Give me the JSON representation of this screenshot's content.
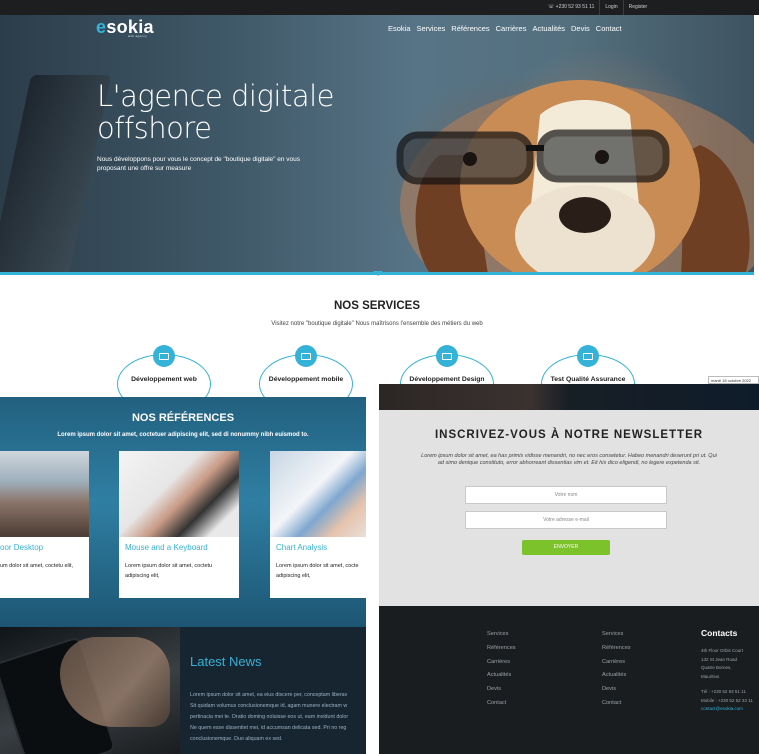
{
  "topbar": {
    "phone": "+230 52 93 51 11",
    "login": "Login",
    "register": "Register"
  },
  "brand": {
    "logo_e": "e",
    "logo_rest": "sokia",
    "logo_sub": "web agency"
  },
  "nav": [
    "Esokia",
    "Services",
    "Références",
    "Carrières",
    "Actualités",
    "Devis",
    "Contact"
  ],
  "hero": {
    "title": "L'agence digitale offshore",
    "desc": "Nous développons pour vous le concept de \"boutique digitale\" en vous proposant une offre sur measure"
  },
  "services": {
    "title": "NOS SERVICES",
    "subtitle": "Visitez notre \"boutique digitale\" Nous maîtrisons l'ensemble des métiers du web",
    "items": [
      "Développement web",
      "Développement mobile",
      "Développement Design",
      "Test Qualité Assurance"
    ]
  },
  "date_tag": "mardi 18 octobre 2022",
  "references": {
    "title": "NOS RÉFÉRENCES",
    "subtitle": "Lorem ipsum dolor sit amet, coctetuer adipiscing elit, sed di nonummy nibh euismod to.",
    "cards": [
      {
        "title": "oor Desktop",
        "desc": "um dolor sit amet, coctetu elit,"
      },
      {
        "title": "Mouse and a Keyboard",
        "desc": "Lorem ipsum dolor sit amet, coctetu adipiscing elit,"
      },
      {
        "title": "Chart Analysis",
        "desc": "Lorem ipsum dolor sit amet, cocte adipiscing elit,"
      }
    ]
  },
  "news": {
    "title": "Latest News",
    "lines": [
      "Lorem ipsum dolor sit amet, ea eius discere per, conceptam liberav",
      "Sit quidam volumus conclusionemque id, agam munere electram w",
      "pertinacia mei te. Oratio doming noluisse eos ut, eam invidunt dolor",
      "Ne quem esse dissentiet mei, id accumsan delicata sed. Pri no reg",
      "conclusionemque. Duo aliquam ex sed."
    ]
  },
  "newsletter": {
    "title": "INSCRIVEZ-VOUS À NOTRE NEWSLETTER",
    "text": "Lorem ipsum dolor sit amet, ea has primis vidisse menandri, no nec eros consetetur. Habeo menandri deserunt pri ut. Qui ad simo denique constituto, error abhorreant dissentias vim et. Eit his dico eligendi, no legere expetenda sit.",
    "name_placeholder": "Votre nom",
    "email_placeholder": "Votre adresse e-mail",
    "submit": "ENVOYER"
  },
  "footer": {
    "col1": [
      "Services",
      "Références",
      "Carrières",
      "Actualités",
      "Devis",
      "Contact"
    ],
    "col2": [
      "Services",
      "Références",
      "Carrières",
      "Actualités",
      "Devis",
      "Contact"
    ],
    "contacts_title": "Contacts",
    "address": [
      "4th Floor Orbis Court",
      "132 St Jean Road",
      "Quatre Bornes,",
      "Mauritius"
    ],
    "tel": "Tél : +230 52 93 51 11",
    "mobile": "Mobile : +230 52 52 33 11",
    "email": "contact@esokia.com"
  },
  "colors": {
    "accent": "#35b2d8",
    "button": "#7cc22a",
    "footer": "#1a1d1f",
    "topbar": "#1d1e20"
  }
}
